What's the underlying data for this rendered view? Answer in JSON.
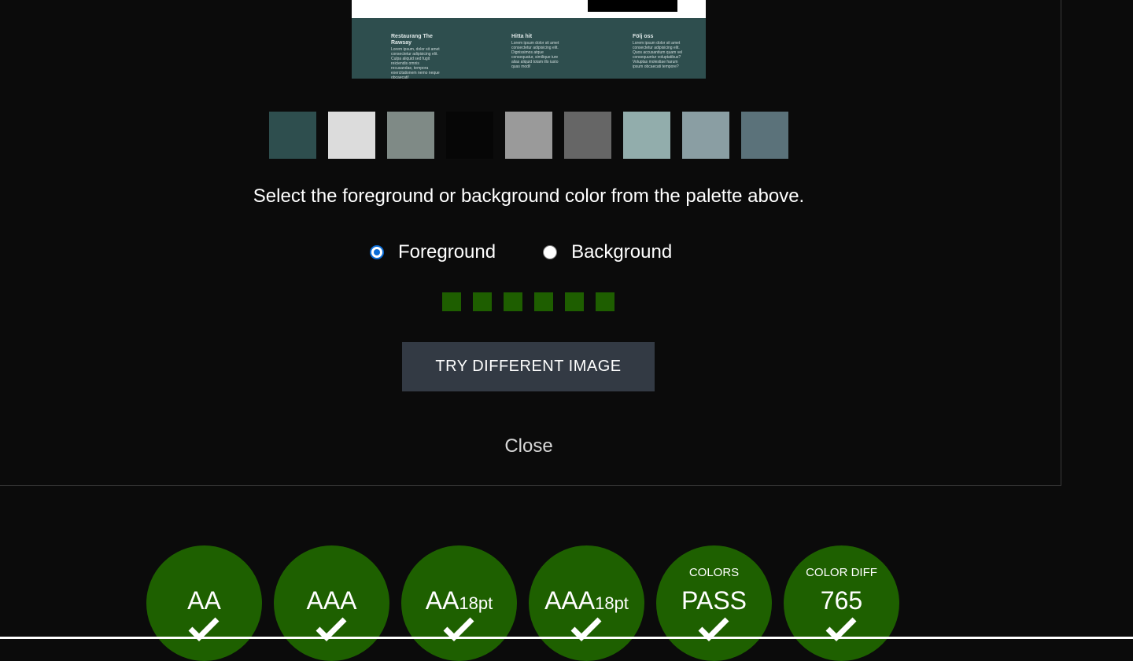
{
  "preview": {
    "columns": [
      {
        "heading": "Restaurang The Rawsay",
        "text": "Lorem ipsum, dolor sit amet consectetur adipisicing elit. Culpa aliquid sed fugit reiciendis omnis recusandae, tempora exercitationem nemo neque obcaecati!"
      },
      {
        "heading": "Hitta hit",
        "text": "Lorem ipsum dolor sit amet consectetur adipisicing elit. Dignissimos atque consequatur, similique iure alias aliquid totam illo iusto quas modi!"
      },
      {
        "heading": "Följ oss",
        "text": "Lorem ipsum dolor sit amet consectetur adipisicing elit. Quos accusantium quam vel consequuntur voluptatibus? Voluptas molestiae harum ipsum obcaecati tempore?"
      }
    ]
  },
  "palette": [
    {
      "name": "dark-teal",
      "color": "#2e4e4e"
    },
    {
      "name": "light-gray",
      "color": "#dcdcdc"
    },
    {
      "name": "gray-green",
      "color": "#7f8a86"
    },
    {
      "name": "near-black",
      "color": "#060606"
    },
    {
      "name": "medium-gray",
      "color": "#9a9a9a"
    },
    {
      "name": "dark-gray",
      "color": "#666666"
    },
    {
      "name": "pale-teal",
      "color": "#92adac"
    },
    {
      "name": "slate-gray",
      "color": "#8a9ea3"
    },
    {
      "name": "steel-blue-gray",
      "color": "#5b727a"
    }
  ],
  "instruction": "Select the foreground or background color from the palette above.",
  "radios": {
    "foreground_label": "Foreground",
    "background_label": "Background",
    "selected": "foreground"
  },
  "progress_steps": 6,
  "try_button_label": "TRY DIFFERENT IMAGE",
  "close_label": "Close",
  "results": [
    {
      "small": "",
      "big": "AA",
      "sub": "",
      "pass": true
    },
    {
      "small": "",
      "big": "AAA",
      "sub": "",
      "pass": true
    },
    {
      "small": "",
      "big": "AA",
      "sub": "18pt",
      "pass": true
    },
    {
      "small": "",
      "big": "AAA",
      "sub": "18pt",
      "pass": true
    },
    {
      "small": "COLORS",
      "big": "PASS",
      "sub": "",
      "pass": true
    },
    {
      "small": "COLOR DIFF",
      "big": "765",
      "sub": "",
      "pass": true
    }
  ],
  "colors": {
    "pass_green": "#1e6000",
    "progress_green": "#1e5e00",
    "button_bg": "#333a44",
    "page_bg": "#0b0b0b"
  }
}
